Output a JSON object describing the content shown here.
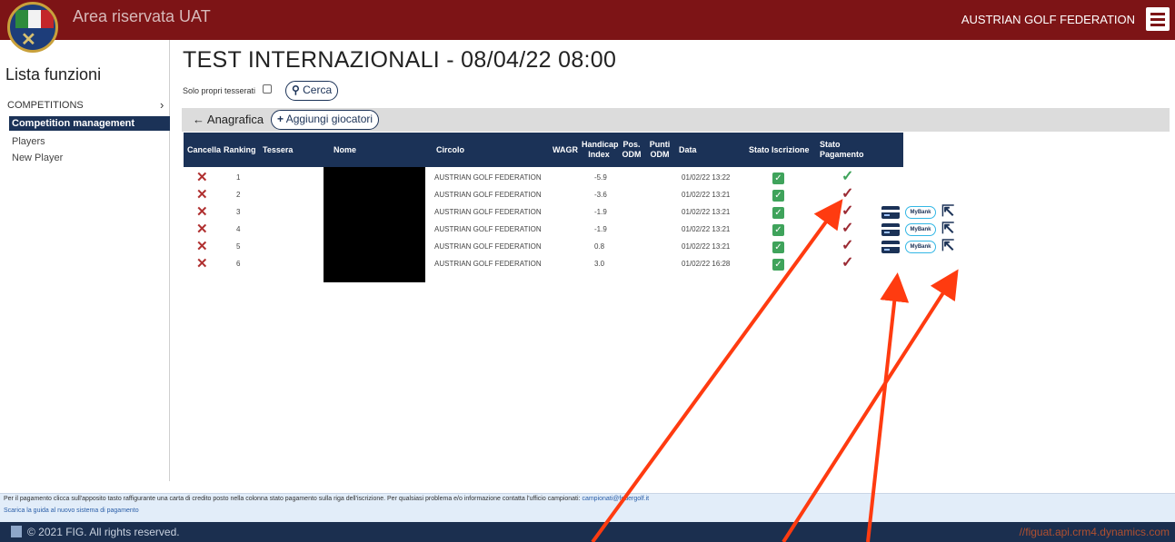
{
  "header": {
    "app_title": "Area riservata UAT",
    "org_name": "AUSTRIAN GOLF FEDERATION"
  },
  "sidebar": {
    "title": "Lista funzioni",
    "section": "COMPETITIONS",
    "items": [
      {
        "label": "Competition management",
        "active": true
      },
      {
        "label": "Players",
        "active": false
      },
      {
        "label": "New Player",
        "active": false
      }
    ]
  },
  "main": {
    "title": "TEST INTERNAZIONALI - 08/04/22 08:00",
    "filter_label": "Solo propri tesserati",
    "search_label": "Cerca",
    "back_label": "Anagrafica",
    "add_label": "Aggiungi giocatori"
  },
  "table": {
    "headers": {
      "cancella": "Cancella",
      "ranking": "Ranking",
      "tessera": "Tessera",
      "nome": "Nome",
      "circolo": "Circolo",
      "wagr": "WAGR",
      "handicap": "Handicap Index",
      "pos_odm": "Pos. ODM",
      "punti_odm": "Punti ODM",
      "data": "Data",
      "stato_iscrizione": "Stato Iscrizione",
      "stato_pagamento": "Stato Pagamento"
    },
    "rows": [
      {
        "ranking": "1",
        "circolo": "AUSTRIAN GOLF FEDERATION",
        "handicap": "-5.9",
        "data": "01/02/22 13:22"
      },
      {
        "ranking": "2",
        "circolo": "AUSTRIAN GOLF FEDERATION",
        "handicap": "-3.6",
        "data": "01/02/22 13:21"
      },
      {
        "ranking": "3",
        "circolo": "AUSTRIAN GOLF FEDERATION",
        "handicap": "-1.9",
        "data": "01/02/22 13:21"
      },
      {
        "ranking": "4",
        "circolo": "AUSTRIAN GOLF FEDERATION",
        "handicap": "-1.9",
        "data": "01/02/22 13:21"
      },
      {
        "ranking": "5",
        "circolo": "AUSTRIAN GOLF FEDERATION",
        "handicap": "0.8",
        "data": "01/02/22 13:21"
      },
      {
        "ranking": "6",
        "circolo": "AUSTRIAN GOLF FEDERATION",
        "handicap": "3.0",
        "data": "01/02/22 16:28"
      }
    ],
    "mybank_label": "MyBank"
  },
  "info": {
    "line1": "Per il pagamento clicca sull'apposito tasto raffigurante una carta di credito posto nella colonna stato pagamento sulla riga dell'iscrizione. Per qualsiasi problema e/o informazione contatta l'ufficio campionati:",
    "email": "campionati@federgolf.it",
    "line2": "Scarica la guida al nuovo sistema di pagamento"
  },
  "footer": {
    "copyright": "© 2021 FIG. All rights reserved.",
    "url": "//figuat.api.crm4.dynamics.com"
  },
  "colors": {
    "brand_red": "#7d1416",
    "navy": "#1b3257",
    "paid_green": "#3fa35b",
    "unpaid_red": "#9b2a33",
    "annotation_arrow": "#ff3b10"
  },
  "icons": [
    "logo-emblem",
    "hamburger-icon",
    "chevron-right-icon",
    "checkbox",
    "search-icon",
    "back-arrow-icon",
    "plus-icon",
    "delete-x-icon",
    "check-icon",
    "credit-card-icon",
    "mybank-icon",
    "share-icon"
  ]
}
